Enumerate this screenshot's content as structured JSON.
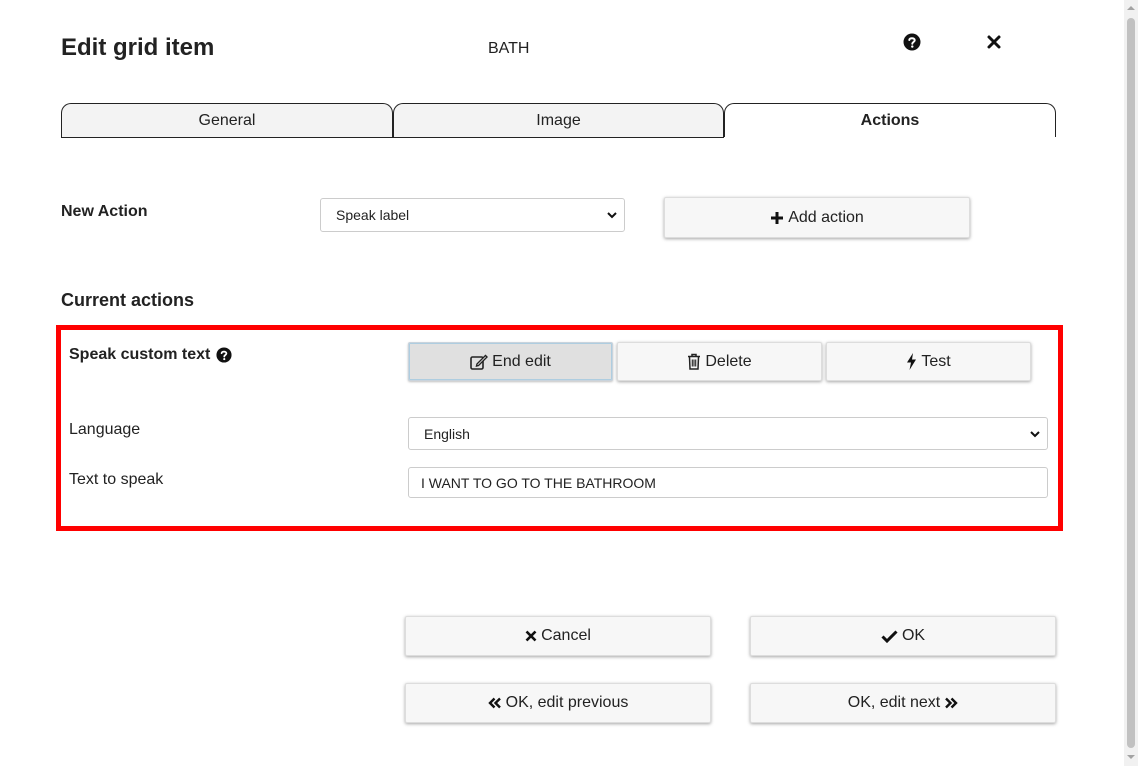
{
  "dialog": {
    "title": "Edit grid item",
    "item_label": "BATH",
    "help_icon": "question-circle-icon",
    "close_icon": "close-icon"
  },
  "tabs": [
    {
      "label": "General",
      "active": false
    },
    {
      "label": "Image",
      "active": false
    },
    {
      "label": "Actions",
      "active": true
    }
  ],
  "new_action": {
    "label": "New Action",
    "selected": "Speak label",
    "add_button": "Add action",
    "add_icon": "plus-icon"
  },
  "current_actions": {
    "heading": "Current actions",
    "action": {
      "title": "Speak custom text",
      "title_icon": "question-circle-icon",
      "end_edit_button": "End edit",
      "end_edit_icon": "edit-icon",
      "delete_button": "Delete",
      "delete_icon": "trash-icon",
      "test_button": "Test",
      "test_icon": "bolt-icon",
      "language_label": "Language",
      "language_value": "English",
      "text_label": "Text to speak",
      "text_value": "I WANT TO GO TO THE BATHROOM"
    }
  },
  "footer": {
    "cancel": "Cancel",
    "cancel_icon": "times-icon",
    "ok": "OK",
    "ok_icon": "check-icon",
    "ok_prev": "OK, edit previous",
    "ok_prev_icon": "angle-double-left-icon",
    "ok_next": "OK, edit next",
    "ok_next_icon": "angle-double-right-icon"
  },
  "colors": {
    "highlight_border": "#ff0000",
    "pressed_button": "#e0e0e0"
  }
}
